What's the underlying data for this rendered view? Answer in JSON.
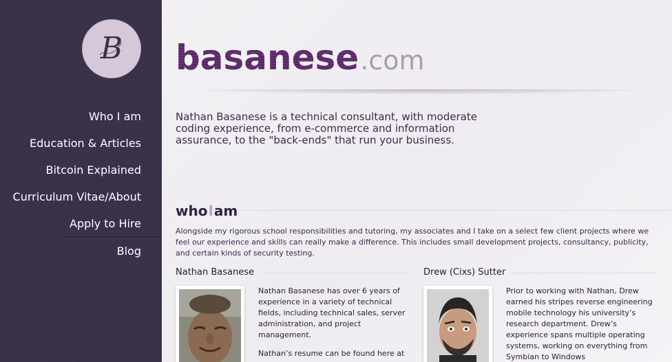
{
  "brand": {
    "logo_letter": "B",
    "name": "basanese",
    "tld": ".com"
  },
  "nav": {
    "items": [
      {
        "label": "Who I am"
      },
      {
        "label": "Education & Articles"
      },
      {
        "label": "Bitcoin Explained"
      },
      {
        "label": "Curriculum Vitae/About"
      },
      {
        "label": "Apply to Hire"
      },
      {
        "label": "Blog"
      }
    ]
  },
  "intro": {
    "text": "Nathan Basanese is a technical consultant, with moderate coding experience, from e-commerce and information assurance, to the \"back-ends\" that run your business."
  },
  "who": {
    "title_left": "who",
    "title_sep": "I",
    "title_right": "am",
    "about": "Alongside my rigorous school responsibilities and tutoring, my associates and I take on a select few client projects where we feel our experience and skills can really make a difference. This includes small development projects, consultancy, publicity, and certain kinds of security testing."
  },
  "people": [
    {
      "name": "Nathan Basanese",
      "photo_icon": "portrait-photo",
      "bio": [
        "Nathan Basanese has over 6 years of experience in a variety of technical fields, including technical sales, server administration, and project management.",
        "Nathan’s resume can be found here at"
      ]
    },
    {
      "name": "Drew (Cixs) Sutter",
      "photo_icon": "portrait-photo",
      "bio": [
        "Prior to working with Nathan, Drew earned his stripes reverse engineering mobile technology his university’s research department. Drew’s experience spans multiple operating systems, working on everything from Symbian to Windows"
      ]
    }
  ],
  "colors": {
    "sidebar": "#3a3149",
    "brand": "#5a2a68",
    "tld": "#a99cb0",
    "logo_circle": "#d6c8d9"
  }
}
